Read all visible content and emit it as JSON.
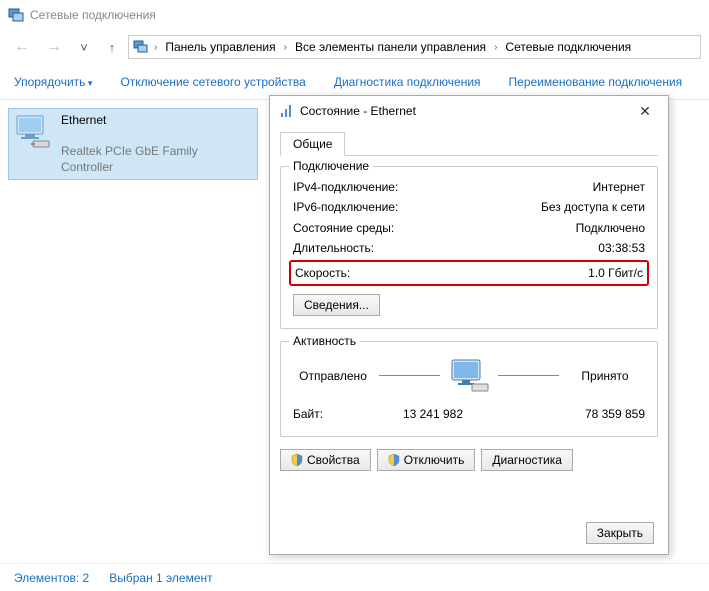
{
  "window": {
    "title": "Сетевые подключения"
  },
  "breadcrumbs": {
    "b1": "Панель управления",
    "b2": "Все элементы панели управления",
    "b3": "Сетевые подключения"
  },
  "toolbar": {
    "organize": "Упорядочить",
    "disable": "Отключение сетевого устройства",
    "diagnose": "Диагностика подключения",
    "rename": "Переименование подключения"
  },
  "connection": {
    "name": "Ethernet",
    "adapter": "Realtek PCIe GbE Family Controller"
  },
  "status_bar": {
    "count": "Элементов: 2",
    "selected": "Выбран 1 элемент"
  },
  "dialog": {
    "title": "Состояние - Ethernet",
    "tab_general": "Общие",
    "group_connection": "Подключение",
    "ipv4_label": "IPv4-подключение:",
    "ipv4_value": "Интернет",
    "ipv6_label": "IPv6-подключение:",
    "ipv6_value": "Без доступа к сети",
    "media_label": "Состояние среды:",
    "media_value": "Подключено",
    "duration_label": "Длительность:",
    "duration_value": "03:38:53",
    "speed_label": "Скорость:",
    "speed_value": "1.0 Гбит/с",
    "details_btn": "Сведения...",
    "group_activity": "Активность",
    "sent": "Отправлено",
    "received": "Принято",
    "bytes_label": "Байт:",
    "bytes_sent": "13 241 982",
    "bytes_recv": "78 359 859",
    "properties_btn": "Свойства",
    "disable_btn": "Отключить",
    "diagnose_btn": "Диагностика",
    "close_btn": "Закрыть"
  }
}
